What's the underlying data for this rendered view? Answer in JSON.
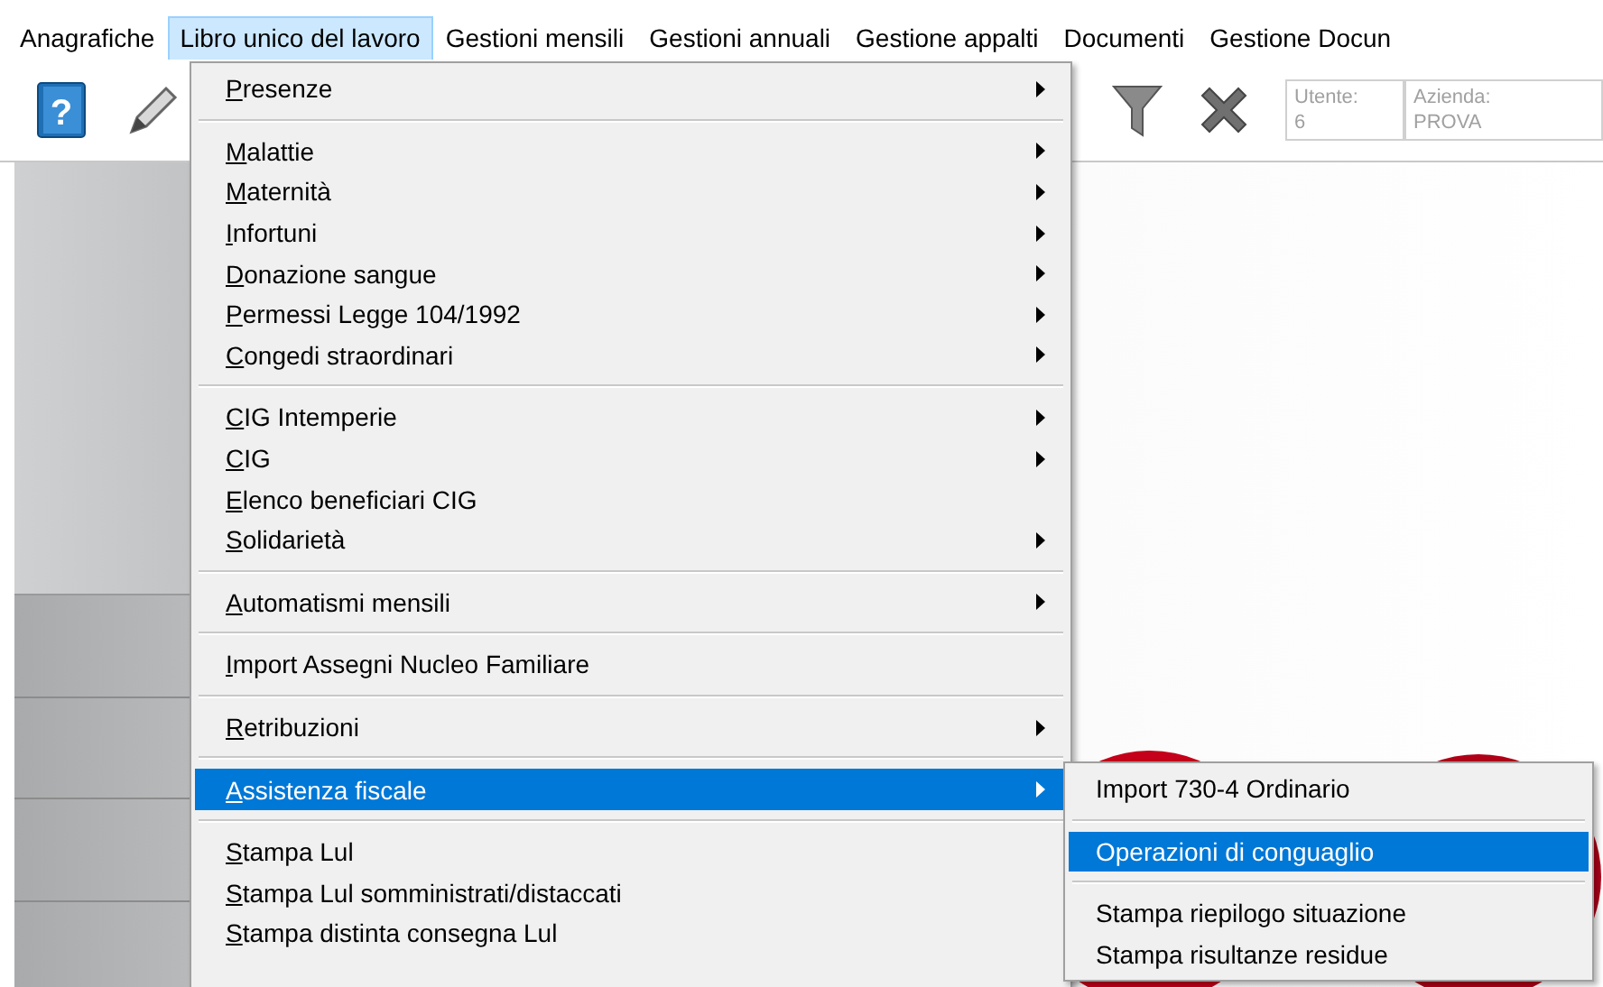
{
  "menubar": [
    {
      "label": "Anagrafiche",
      "selected": false
    },
    {
      "label": "Libro unico del lavoro",
      "selected": true
    },
    {
      "label": "Gestioni mensili",
      "selected": false
    },
    {
      "label": "Gestioni annuali",
      "selected": false
    },
    {
      "label": "Gestione appalti",
      "selected": false
    },
    {
      "label": "Documenti",
      "selected": false
    },
    {
      "label": "Gestione Docun",
      "selected": false
    }
  ],
  "toolbar": {
    "help_glyph": "?",
    "user": {
      "label": "Utente:",
      "value": "6"
    },
    "company": {
      "label": "Azienda:",
      "value": "PROVA"
    }
  },
  "menu": {
    "groups": [
      [
        {
          "label": "Presenze",
          "submenu": true,
          "selected": false
        }
      ],
      [
        {
          "label": "Malattie",
          "submenu": true,
          "selected": false
        },
        {
          "label": "Maternità",
          "submenu": true,
          "selected": false
        },
        {
          "label": "Infortuni",
          "submenu": true,
          "selected": false
        },
        {
          "label": "Donazione sangue",
          "submenu": true,
          "selected": false
        },
        {
          "label": "Permessi Legge 104/1992",
          "submenu": true,
          "selected": false
        },
        {
          "label": "Congedi straordinari",
          "submenu": true,
          "selected": false
        }
      ],
      [
        {
          "label": "CIG Intemperie",
          "submenu": true,
          "selected": false
        },
        {
          "label": "CIG",
          "submenu": true,
          "selected": false
        },
        {
          "label": "Elenco beneficiari CIG",
          "submenu": false,
          "selected": false
        },
        {
          "label": "Solidarietà",
          "submenu": true,
          "selected": false
        }
      ],
      [
        {
          "label": "Automatismi mensili",
          "submenu": true,
          "selected": false
        }
      ],
      [
        {
          "label": "Import Assegni Nucleo Familiare",
          "submenu": false,
          "selected": false
        }
      ],
      [
        {
          "label": "Retribuzioni",
          "submenu": true,
          "selected": false
        }
      ],
      [
        {
          "label": "Assistenza fiscale",
          "submenu": true,
          "selected": true
        }
      ],
      [
        {
          "label": "Stampa Lul",
          "submenu": false,
          "selected": false
        },
        {
          "label": "Stampa Lul somministrati/distaccati",
          "submenu": false,
          "selected": false
        },
        {
          "label": "Stampa distinta consegna Lul",
          "submenu": false,
          "selected": false
        }
      ]
    ]
  },
  "submenu": {
    "groups": [
      [
        {
          "label": "Import 730-4 Ordinario",
          "selected": false
        }
      ],
      [
        {
          "label": "Operazioni di conguaglio",
          "selected": true
        }
      ],
      [
        {
          "label": "Stampa riepilogo situazione",
          "selected": false
        },
        {
          "label": "Stampa risultanze residue",
          "selected": false
        }
      ]
    ]
  }
}
